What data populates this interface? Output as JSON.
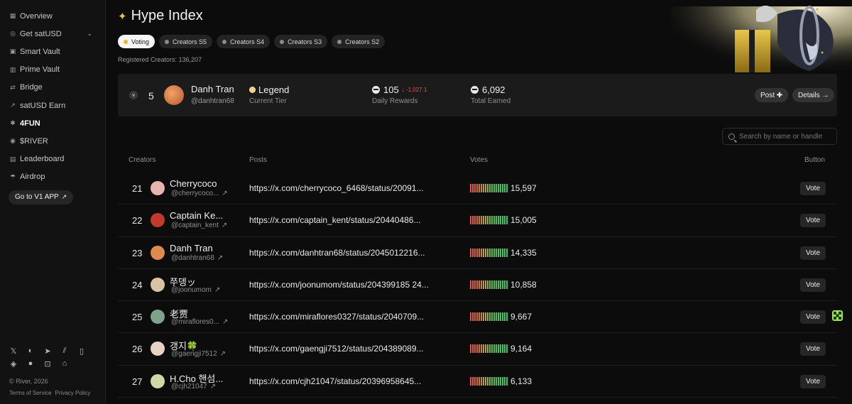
{
  "sidebar": {
    "items": [
      {
        "label": "Overview",
        "icon": "grid-icon"
      },
      {
        "label": "Get satUSD",
        "icon": "coin-icon",
        "has_chevron": true
      },
      {
        "label": "Smart Vault",
        "icon": "vault-icon"
      },
      {
        "label": "Prime Vault",
        "icon": "door-icon"
      },
      {
        "label": "Bridge",
        "icon": "swap-icon"
      },
      {
        "label": "satUSD Earn",
        "icon": "chart-icon"
      },
      {
        "label": "4FUN",
        "icon": "bug-icon",
        "active": true
      },
      {
        "label": "$RIVER",
        "icon": "river-coin-icon"
      },
      {
        "label": "Leaderboard",
        "icon": "leaderboard-icon"
      },
      {
        "label": "Airdrop",
        "icon": "airdrop-icon"
      }
    ],
    "v1_button": "Go to V1 APP",
    "copyright": "© River, 2026",
    "terms": "Terms of Service",
    "privacy": "Privacy Policy"
  },
  "page": {
    "title": "Hype Index",
    "tabs": [
      "Voting",
      "Creators S5",
      "Creators S4",
      "Creators S3",
      "Creators S2"
    ],
    "active_tab": 0,
    "registered": "Registered Creators: 136,207"
  },
  "user_card": {
    "rank": "5",
    "name": "Danh Tran",
    "handle": "@danhtran68",
    "tier": "Legend",
    "tier_label": "Current Tier",
    "daily_rewards": "105",
    "daily_delta": "↓ -1,027.1",
    "daily_label": "Daily Rewards",
    "total_earned": "6,092",
    "earned_label": "Total Earned",
    "post_button": "Post ✚",
    "details_button": "Details →"
  },
  "search": {
    "placeholder": "Search by name or handle"
  },
  "table": {
    "headers": {
      "creators": "Creators",
      "posts": "Posts",
      "votes": "Votes",
      "button": "Button"
    },
    "vote_label": "Vote",
    "rows": [
      {
        "rank": "21",
        "name": "Cherrycoco",
        "handle": "@cherrycoco...",
        "url": "https://x.com/cherrycoco_6468/status/20091...",
        "votes": "15,597",
        "avatar_color": "#e8b4b0"
      },
      {
        "rank": "22",
        "name": "Captain Ke...",
        "handle": "@captain_kent",
        "url": "https://x.com/captain_kent/status/20440486...",
        "votes": "15,005",
        "avatar_color": "#c0392b"
      },
      {
        "rank": "23",
        "name": "Danh Tran",
        "handle": "@danhtran68",
        "url": "https://x.com/danhtran68/status/2045012216...",
        "votes": "14,335",
        "avatar_color": "#e08a4f"
      },
      {
        "rank": "24",
        "name": "쭈뎅ッ",
        "handle": "@joonumom",
        "url": "https://x.com/joonumom/status/204399185 24...",
        "votes": "10,858",
        "avatar_color": "#d9c3a5"
      },
      {
        "rank": "25",
        "name": "老贾",
        "handle": "@miraflores0...",
        "url": "https://x.com/miraflores0327/status/2040709...",
        "votes": "9,667",
        "avatar_color": "#7fa38a"
      },
      {
        "rank": "26",
        "name": "갱지🍀",
        "handle": "@gaengji7512",
        "url": "https://x.com/gaengji7512/status/204389089...",
        "votes": "9,164",
        "avatar_color": "#e9d2c4"
      },
      {
        "rank": "27",
        "name": "H.Cho 핸섬...",
        "handle": "@cjh21047",
        "url": "https://x.com/cjh21047/status/20396958645...",
        "votes": "6,133",
        "avatar_color": "#cfd8a6"
      }
    ]
  },
  "colors": {
    "accent": "#f0b429",
    "danger": "#e05555",
    "success": "#3cc26b",
    "float": "#9be15d"
  }
}
